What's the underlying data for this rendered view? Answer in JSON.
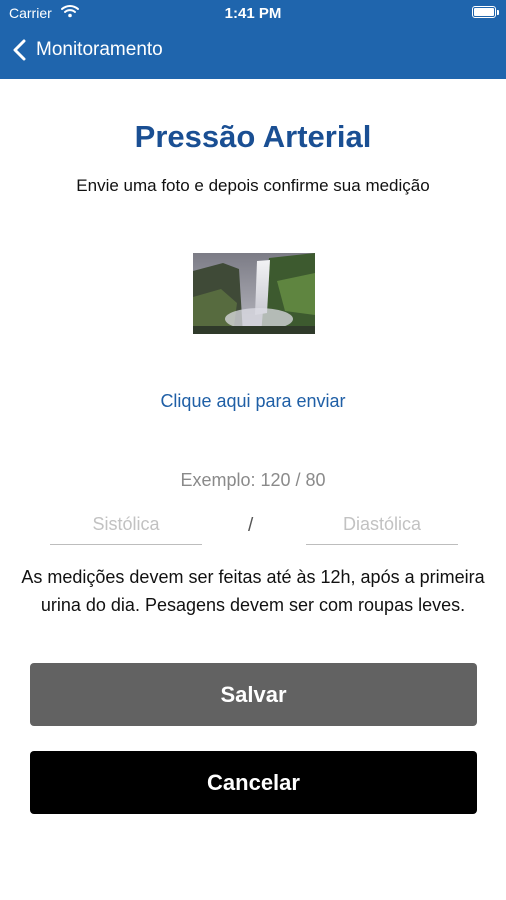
{
  "status_bar": {
    "carrier": "Carrier",
    "time": "1:41 PM"
  },
  "nav": {
    "back_label": "Monitoramento"
  },
  "main": {
    "title": "Pressão Arterial",
    "subtitle": "Envie uma foto e depois confirme sua medição",
    "upload_link": "Clique aqui para enviar",
    "example": "Exemplo: 120 / 80",
    "systolic_placeholder": "Sistólica",
    "diastolic_placeholder": "Diastólica",
    "separator": "/",
    "note": "As medições devem ser feitas até às 12h, após a primeira urina do dia. Pesagens devem ser com roupas leves."
  },
  "buttons": {
    "save": "Salvar",
    "cancel": "Cancelar"
  },
  "colors": {
    "header": "#1f65ad",
    "title": "#1a4f93",
    "link": "#1f5fa6",
    "save_button": "#626262",
    "cancel_button": "#000000"
  },
  "icons": {
    "back": "chevron-left-icon",
    "wifi": "wifi-icon",
    "battery": "battery-icon"
  }
}
